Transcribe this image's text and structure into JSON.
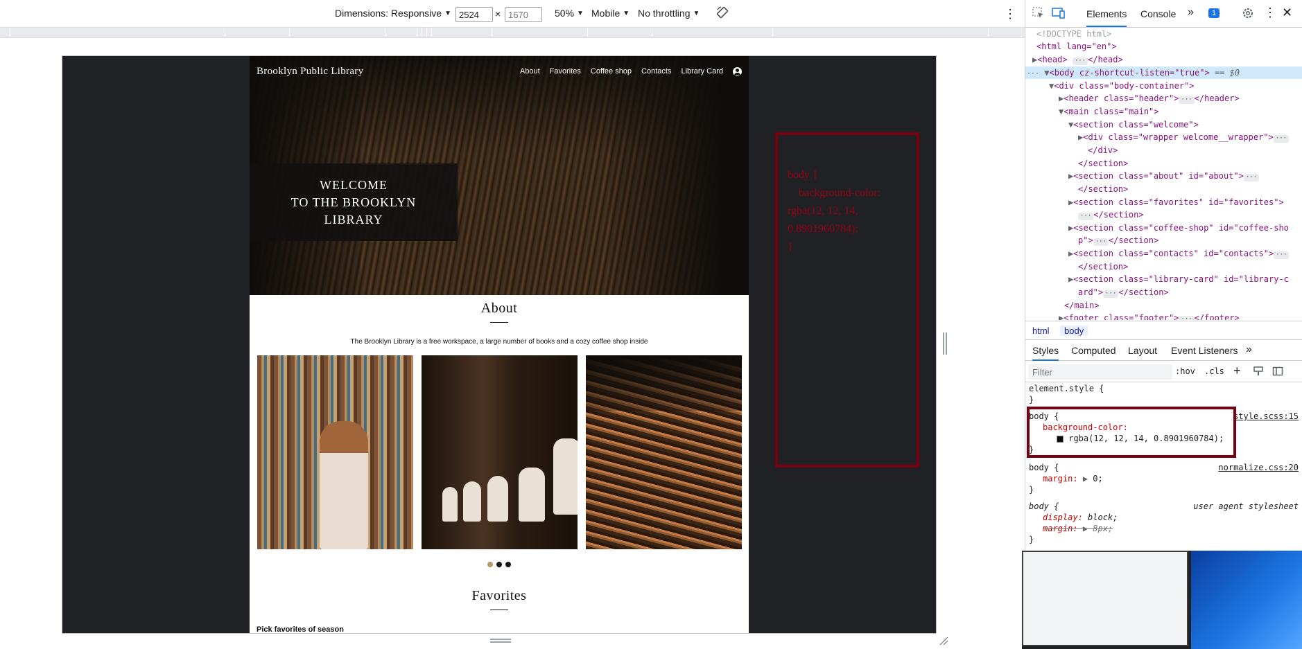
{
  "toolbar": {
    "dimensions_label": "Dimensions: Responsive",
    "width_value": "2524",
    "height_placeholder": "1670",
    "times": "×",
    "zoom": "50%",
    "device_type": "Mobile",
    "throttling": "No throttling",
    "more": "⋮"
  },
  "site": {
    "logo": "Brooklyn Public Library",
    "nav": [
      "About",
      "Favorites",
      "Coffee shop",
      "Contacts",
      "Library Card"
    ],
    "welcome_line1": "WELCOME",
    "welcome_line2": "TO THE BROOKLYN",
    "welcome_line3": "LIBRARY",
    "about_title": "About",
    "about_text": "The Brooklyn Library is a free workspace, a large number of books and a cozy coffee shop inside",
    "favorites_title": "Favorites",
    "favorites_subtitle": "Pick favorites of season"
  },
  "annotation": {
    "text": "body {\n    background-color: rgba(12, 12, 14, 0.8901960784);\n}"
  },
  "devtools": {
    "tabs": [
      "Elements",
      "Console"
    ],
    "active_tab": "Elements",
    "more_tabs": "»",
    "issues_badge": "1",
    "dom": {
      "doctype": "<!DOCTYPE html>",
      "html_open": "<html lang=\"en\">",
      "head": "<head>",
      "head_close": "</head>",
      "body_tag": "<body cz-shortcut-listen=\"true\">",
      "body_eq": "== $0",
      "div_body_container": "<div class=\"body-container\">",
      "header": "<header class=\"header\">",
      "header_close": "</header>",
      "main_open": "<main class=\"main\">",
      "section_welcome": "<section class=\"welcome\">",
      "div_wrapper": "<div class=\"wrapper welcome__wrapper\">",
      "div_close": "</div>",
      "section_close": "</section>",
      "section_about": "<section class=\"about\" id=\"about\">",
      "section_favorites": "<section class=\"favorites\" id=\"favorites\">",
      "section_coffee_a": "<section class=\"coffee-shop\" id=\"coffee-sho",
      "section_coffee_b": "p\">",
      "section_contacts": "<section class=\"contacts\" id=\"contacts\">",
      "section_card_a": "<section class=\"library-card\" id=\"library-c",
      "section_card_b": "ard\">",
      "main_close": "</main>",
      "footer": "<footer class=\"footer\">",
      "footer_close": "</footer>"
    },
    "breadcrumbs": [
      "html",
      "body"
    ],
    "style_tabs": [
      "Styles",
      "Computed",
      "Layout",
      "Event Listeners"
    ],
    "filter_placeholder": "Filter",
    "hov": ":hov",
    "cls": ".cls",
    "rules": {
      "element_style": "element.style {",
      "close_brace": "}",
      "r1_selector": "body {",
      "r1_source": "style.scss:15",
      "r1_prop": "background-color:",
      "r1_value": "rgba(12, 12, 14, 0.8901960784);",
      "r2_selector": "body {",
      "r2_source": "normalize.css:20",
      "r2_prop": "margin:",
      "r2_value": "0;",
      "r3_selector": "body {",
      "r3_source": "user agent stylesheet",
      "r3_prop1": "display:",
      "r3_value1": "block;",
      "r3_prop2": "margin:",
      "r3_value2": "8px;"
    }
  },
  "colors": {
    "viewport_bg": "#202124",
    "annotation_border": "#7a0010",
    "accent": "#1a73e8"
  }
}
